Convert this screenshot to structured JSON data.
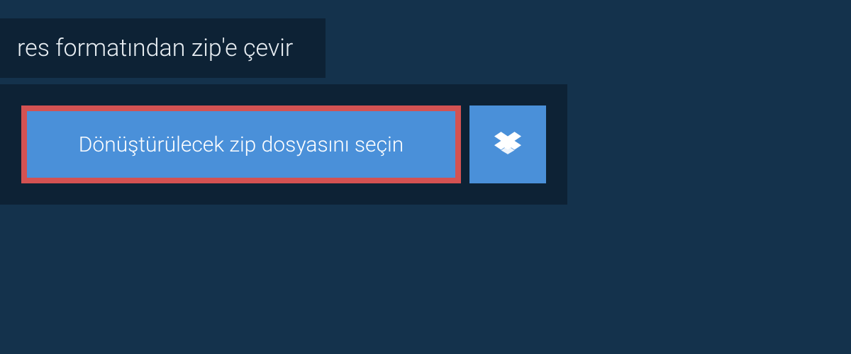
{
  "heading": {
    "text": "res formatından zip'e çevir"
  },
  "upload": {
    "selectFileLabel": "Dönüştürülecek zip dosyasını seçin"
  }
}
